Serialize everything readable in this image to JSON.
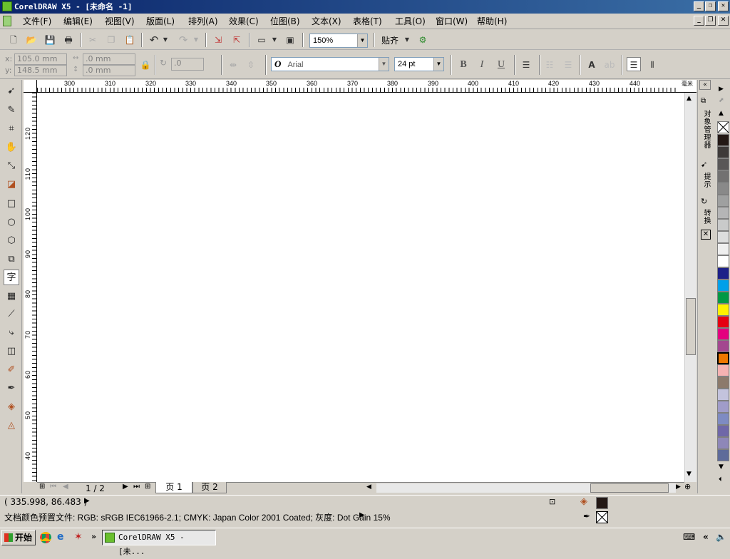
{
  "window": {
    "title": "CorelDRAW X5 - [未命名 -1]"
  },
  "menu": [
    "文件(F)",
    "编辑(E)",
    "视图(V)",
    "版面(L)",
    "排列(A)",
    "效果(C)",
    "位图(B)",
    "文本(X)",
    "表格(T)",
    "工具(O)",
    "窗口(W)",
    "帮助(H)"
  ],
  "toolbar": {
    "zoom": "150%",
    "snap_label": "贴齐"
  },
  "props": {
    "x_label": "x:",
    "x": "105.0 mm",
    "y_label": "y:",
    "y": "148.5 mm",
    "w": ".0 mm",
    "h": ".0 mm",
    "angle": ".0",
    "font": "Arial",
    "size": "24 pt",
    "bold": "B",
    "italic": "I",
    "underline": "U"
  },
  "ruler_h": {
    "ticks": [
      "300",
      "310",
      "320",
      "330",
      "340",
      "350",
      "360",
      "370",
      "380",
      "390",
      "400",
      "410",
      "420",
      "430",
      "440"
    ],
    "unit": "毫米"
  },
  "ruler_v": {
    "ticks": [
      "120",
      "110",
      "100",
      "90",
      "80",
      "70",
      "60",
      "50",
      "40"
    ]
  },
  "pages": {
    "counter": "1 / 2",
    "tab1": "页 1",
    "tab2": "页 2"
  },
  "docker": {
    "tab1": "对象管理器",
    "tab2": "提示",
    "tab3": "转换"
  },
  "status": {
    "coords": "( 335.998, 86.483 )",
    "profile": "文档颜色预置文件: RGB: sRGB IEC61966-2.1; CMYK: Japan Color 2001 Coated; 灰度: Dot Gain 15%"
  },
  "taskbar": {
    "start": "开始",
    "task": "CorelDRAW X5 - [未..."
  },
  "palette_colors": [
    "#231815",
    "#3e3a39",
    "#595757",
    "#727171",
    "#898989",
    "#9fa0a0",
    "#b5b5b6",
    "#c9caca",
    "#dcdddd",
    "#efefef",
    "#ffffff",
    "#1d2088",
    "#00a0e9",
    "#009944",
    "#fff100",
    "#e60012",
    "#e4007f",
    "#a3478f",
    "#ee7800",
    "#f5b2b2",
    "#8c7a6b",
    "#c3c3dd",
    "#a09cc9",
    "#7e8bc2",
    "#6f67a8",
    "#8e87b8",
    "#5e6b9a"
  ]
}
